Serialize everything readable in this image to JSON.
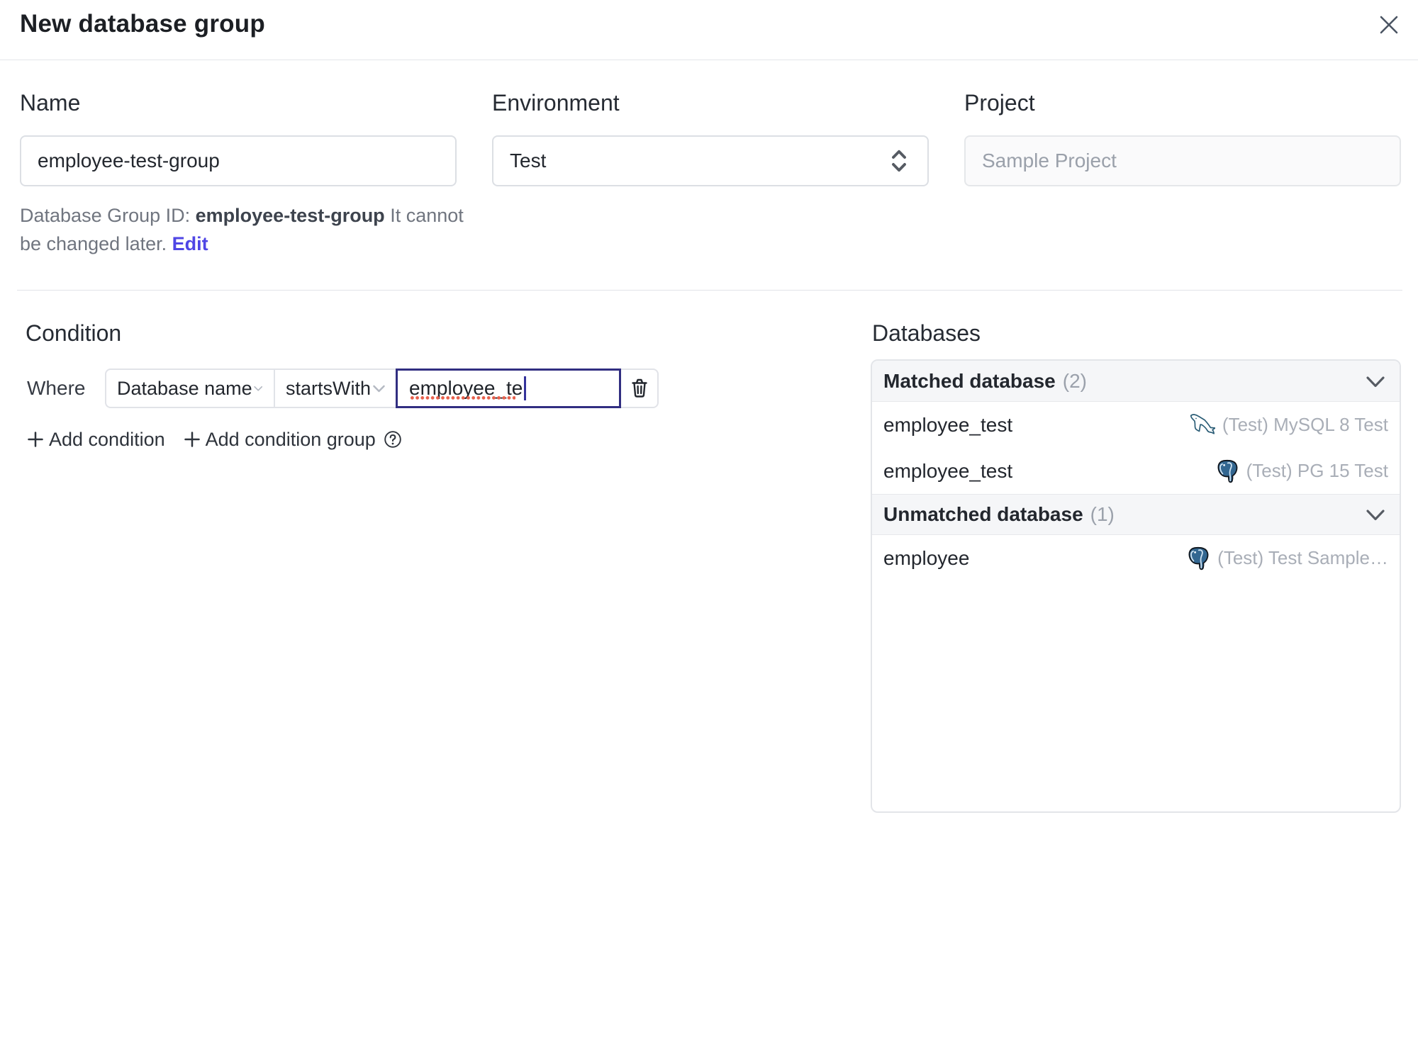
{
  "header": {
    "title": "New database group"
  },
  "fields": {
    "name": {
      "label": "Name",
      "value": "employee-test-group"
    },
    "environment": {
      "label": "Environment",
      "value": "Test"
    },
    "project": {
      "label": "Project",
      "value": "Sample Project"
    }
  },
  "helper": {
    "prefix": "Database Group ID: ",
    "id": "employee-test-group",
    "suffix": " It cannot be changed later. ",
    "edit_label": "Edit"
  },
  "condition": {
    "heading": "Condition",
    "where_label": "Where",
    "factor": "Database name",
    "operator": "startsWith",
    "value": "employee_te",
    "add_condition_label": "Add condition",
    "add_condition_group_label": "Add condition group"
  },
  "databases": {
    "heading": "Databases",
    "matched": {
      "title": "Matched database",
      "count": "(2)",
      "rows": [
        {
          "name": "employee_test",
          "engine": "mysql",
          "instance": "(Test) MySQL 8 Test"
        },
        {
          "name": "employee_test",
          "engine": "postgresql",
          "instance": "(Test) PG 15 Test"
        }
      ]
    },
    "unmatched": {
      "title": "Unmatched database",
      "count": "(1)",
      "rows": [
        {
          "name": "employee",
          "engine": "postgresql",
          "instance": "(Test) Test Sample…"
        }
      ]
    }
  },
  "colors": {
    "accent": "#4f46e5",
    "focus_border": "#312e81",
    "spellcheck": "#e8604c"
  }
}
